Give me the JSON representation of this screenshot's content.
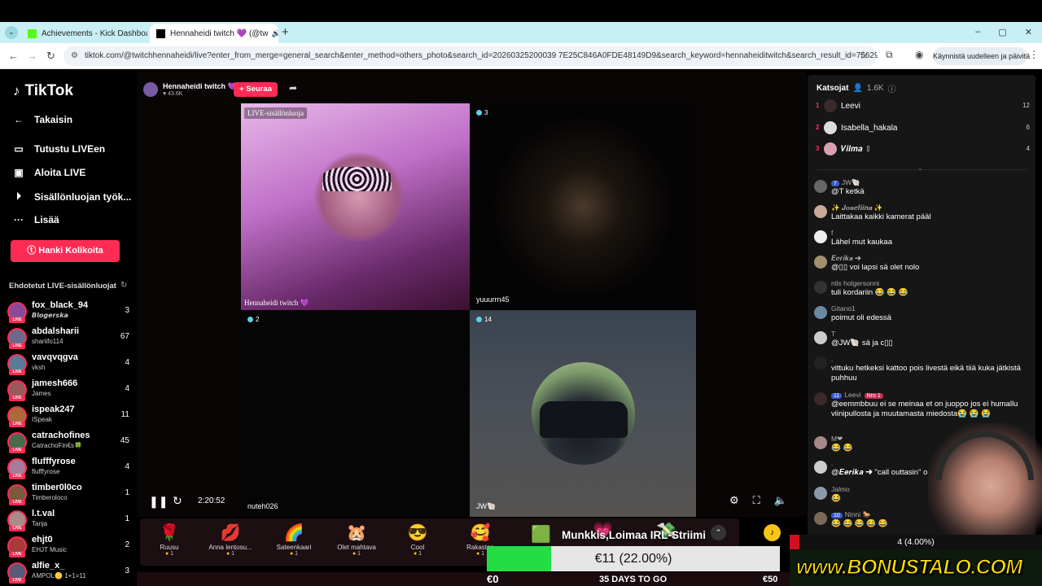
{
  "browser": {
    "tabs": [
      {
        "title": "Achievements - Kick Dashboard",
        "icon": "kick-icon"
      },
      {
        "title": "Hennaheidi twitch 💜 (@tw",
        "icon": "tiktok-icon"
      }
    ],
    "url": "tiktok.com/@twitchhennaheidi/live?enter_from_merge=general_search&enter_method=others_photo&search_id=20260325200039 7E25C846A0FDE48149D9&search_keyword=hennaheiditwitch&search_result_id=7562907711588...",
    "restart_label": "Käynnistä uudelleen ja päivitä",
    "win_controls": [
      "–",
      "▢",
      "✕"
    ]
  },
  "sidebar": {
    "logo": "TikTok",
    "nav": [
      {
        "icon": "back-arrow-icon",
        "glyph": "←",
        "label": "Takaisin"
      },
      {
        "icon": "live-icon",
        "glyph": "▭",
        "label": "Tutustu LIVEen"
      },
      {
        "icon": "camera-icon",
        "glyph": "▣",
        "label": "Aloita LIVE"
      },
      {
        "icon": "creator-tools-icon",
        "glyph": "⏵",
        "label": "Sisällönluojan työk..."
      },
      {
        "icon": "more-icon",
        "glyph": "···",
        "label": "Lisää"
      }
    ],
    "coins_button": "Hanki Kolikoita",
    "suggested_title": "Ehdotetut LIVE-sisällönluojat",
    "live_tag": "LIVE",
    "creators": [
      {
        "name": "fox_black_94",
        "sub": "𝘽𝙡𝙤𝙜𝙚𝙧𝙨𝙠𝙖",
        "count": "3",
        "color": "#8a4a9a"
      },
      {
        "name": "abdalsharii",
        "sub": "shariifo114",
        "count": "67",
        "color": "#6a6a8a"
      },
      {
        "name": "vavqvqgva",
        "sub": "vksh",
        "count": "4",
        "color": "#5a7a9a"
      },
      {
        "name": "jamesh666",
        "sub": "James",
        "count": "4",
        "color": "#9a5a5a"
      },
      {
        "name": "ispeak247",
        "sub": "ISpeak",
        "count": "11",
        "color": "#aa6a3a"
      },
      {
        "name": "catrachofines",
        "sub": "CatrachoFin€s🍀",
        "count": "45",
        "color": "#4a6a4a"
      },
      {
        "name": "flufffyrose",
        "sub": "flufffyrose",
        "count": "4",
        "color": "#aa7a9a"
      },
      {
        "name": "timber0l0co",
        "sub": "Timberoloco",
        "count": "1",
        "color": "#7a5a3a"
      },
      {
        "name": "l.t.val",
        "sub": "Tanja",
        "count": "1",
        "color": "#aa8a8a"
      },
      {
        "name": "ehjt0",
        "sub": "EHJT Music",
        "count": "2",
        "color": "#aa3a3a"
      },
      {
        "name": "alfie_x_",
        "sub": "AMPOL🟡 1+1=11",
        "count": "3",
        "color": "#5a5a7a"
      }
    ]
  },
  "stream": {
    "host_name": "Hennaheidi twitch 💜",
    "host_likes": "♥ 43.6K",
    "follow": "+ Seuraa",
    "live_badge": "LIVE-sisällönluoja",
    "cells": [
      {
        "name": "Hennaheidi twitch 💜",
        "viewers": ""
      },
      {
        "name": "yuuurrn45",
        "viewers": "3"
      },
      {
        "name": "nuteh026",
        "viewers": "2"
      },
      {
        "name": "JW🐚",
        "viewers": "14"
      }
    ],
    "timer": "2:20:52"
  },
  "gifts": [
    {
      "name": "Ruusu",
      "price": "1",
      "glyph": "🌹"
    },
    {
      "name": "Anna lentosu...",
      "price": "1",
      "glyph": "💋"
    },
    {
      "name": "Sateenkaari",
      "price": "1",
      "glyph": "🌈"
    },
    {
      "name": "Olet mahtava",
      "price": "1",
      "glyph": "🐹"
    },
    {
      "name": "Cool",
      "price": "1",
      "glyph": "😎"
    },
    {
      "name": "Rakastan",
      "price": "1",
      "glyph": "🥰"
    }
  ],
  "goal": {
    "title": "Munkkis,Loimaa IRL-Striimi",
    "progress_text": "€11 (22.00%)",
    "progress_fraction": 0.22,
    "min": "€0",
    "days": "35 DAYS TO GO",
    "max": "€50"
  },
  "chat": {
    "viewers_label": "Katsojat",
    "viewers_count": "1.6K",
    "top_viewers": [
      {
        "rank": "1",
        "name": "Leevi",
        "score": "12",
        "color": "#3a2a2a"
      },
      {
        "rank": "2",
        "name": "Isabella_hakala",
        "score": "6",
        "color": "#ddd"
      },
      {
        "rank": "3",
        "name": "𝑽𝒊𝒍𝒎𝒂 ▯",
        "score": "4",
        "color": "#d9a0b0"
      }
    ],
    "messages": [
      {
        "user": "JW🐚",
        "badge": "7",
        "text": "@T ketkä",
        "color": "#666"
      },
      {
        "user": "✨ 𝑱𝒐𝒔𝒆𝒇𝒊𝒊𝒏𝒂 ✨",
        "badge": "",
        "text": "Laittakaa kaikki kamerat pääl",
        "color": "#c9a89a"
      },
      {
        "user": "f",
        "badge": "",
        "text": "Lähel mut kaukaa",
        "color": "#eee"
      },
      {
        "user": "𝑬𝒆𝒓𝒊𝒌𝒂 ➜",
        "badge": "",
        "text": "@▯▯ voi lapsi sä olet nolo",
        "color": "#a09070"
      },
      {
        "user": "nils holgersonni",
        "badge": "",
        "text": "tuli kordariin 😂 😂 😂",
        "color": "#333"
      },
      {
        "user": "Gitano1",
        "badge": "",
        "text": "poimut oli edessä",
        "color": "#6a8aa0"
      },
      {
        "user": "T",
        "badge": "",
        "text": "@JW🐚 sä ja c▯▯",
        "color": "#ccc"
      },
      {
        "user": ".",
        "badge": "",
        "text": "vittuku hetkeksi kattoo pois livestä eikä tiiä kuka jätkistä puhhuu",
        "color": "#222"
      },
      {
        "user": "Leevi",
        "badge": "11",
        "badge2": "Nro 1",
        "text": "@eemmbbuu ei se meinaa et on juoppo jos ei humallu viinipullosta ja muutamasta miedosta😭 😭 😭",
        "color": "#3a2a2a"
      },
      {
        "user": "M❤",
        "badge": "",
        "text": "😂 😂",
        "color": "#aa8888"
      },
      {
        "user": ".",
        "badge": "",
        "text": "@𝑬𝒆𝒓𝒊𝒌𝒂 ➜ \"call outtasin\" o",
        "color": "#ccc"
      },
      {
        "user": "Jalmo",
        "badge": "",
        "text": "😂",
        "color": "#8a9aaa"
      },
      {
        "user": "Ninni 🐎",
        "badge": "10",
        "text": "😂 😂 😂 😂 😂",
        "color": "#7a6a5a"
      }
    ]
  },
  "overlay": {
    "bonus_text": "4 (4.00%)",
    "bonus_fraction": 0.04,
    "bonus_logo": "www.BONUSTALO.COM"
  }
}
